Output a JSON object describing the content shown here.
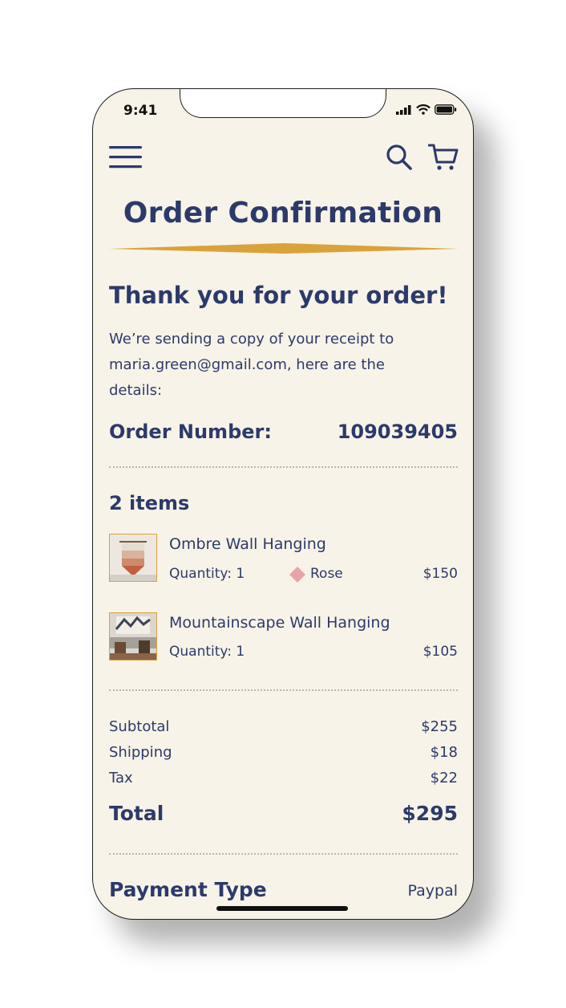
{
  "status_bar": {
    "time": "9:41"
  },
  "header": {
    "menu_icon": "hamburger-icon",
    "search_icon": "search-icon",
    "cart_icon": "cart-icon"
  },
  "page": {
    "title": "Order Confirmation"
  },
  "confirmation": {
    "heading": "Thank you for your order!",
    "message_line1": "We’re sending a copy of your receipt to",
    "message_line2": "maria.green@gmail.com, here are the",
    "message_line3": "details:"
  },
  "order": {
    "number_label": "Order Number:",
    "number_value": "109039405"
  },
  "items": {
    "count_label": "2 items",
    "list": [
      {
        "name": "Ombre Wall Hanging",
        "quantity": "Quantity: 1",
        "color": "Rose",
        "color_hex": "#e9a3a6",
        "price": "$150"
      },
      {
        "name": "Mountainscape Wall Hanging",
        "quantity": "Quantity: 1",
        "price": "$105"
      }
    ]
  },
  "summary": {
    "subtotal_label": "Subtotal",
    "subtotal_value": "$255",
    "shipping_label": "Shipping",
    "shipping_value": "$18",
    "tax_label": "Tax",
    "tax_value": "$22",
    "total_label": "Total",
    "total_value": "$295"
  },
  "payment": {
    "label": "Payment Type",
    "value": "Paypal"
  },
  "colors": {
    "accent": "#d9a23b",
    "primary": "#2c3a6b",
    "background": "#f8f3e8"
  }
}
